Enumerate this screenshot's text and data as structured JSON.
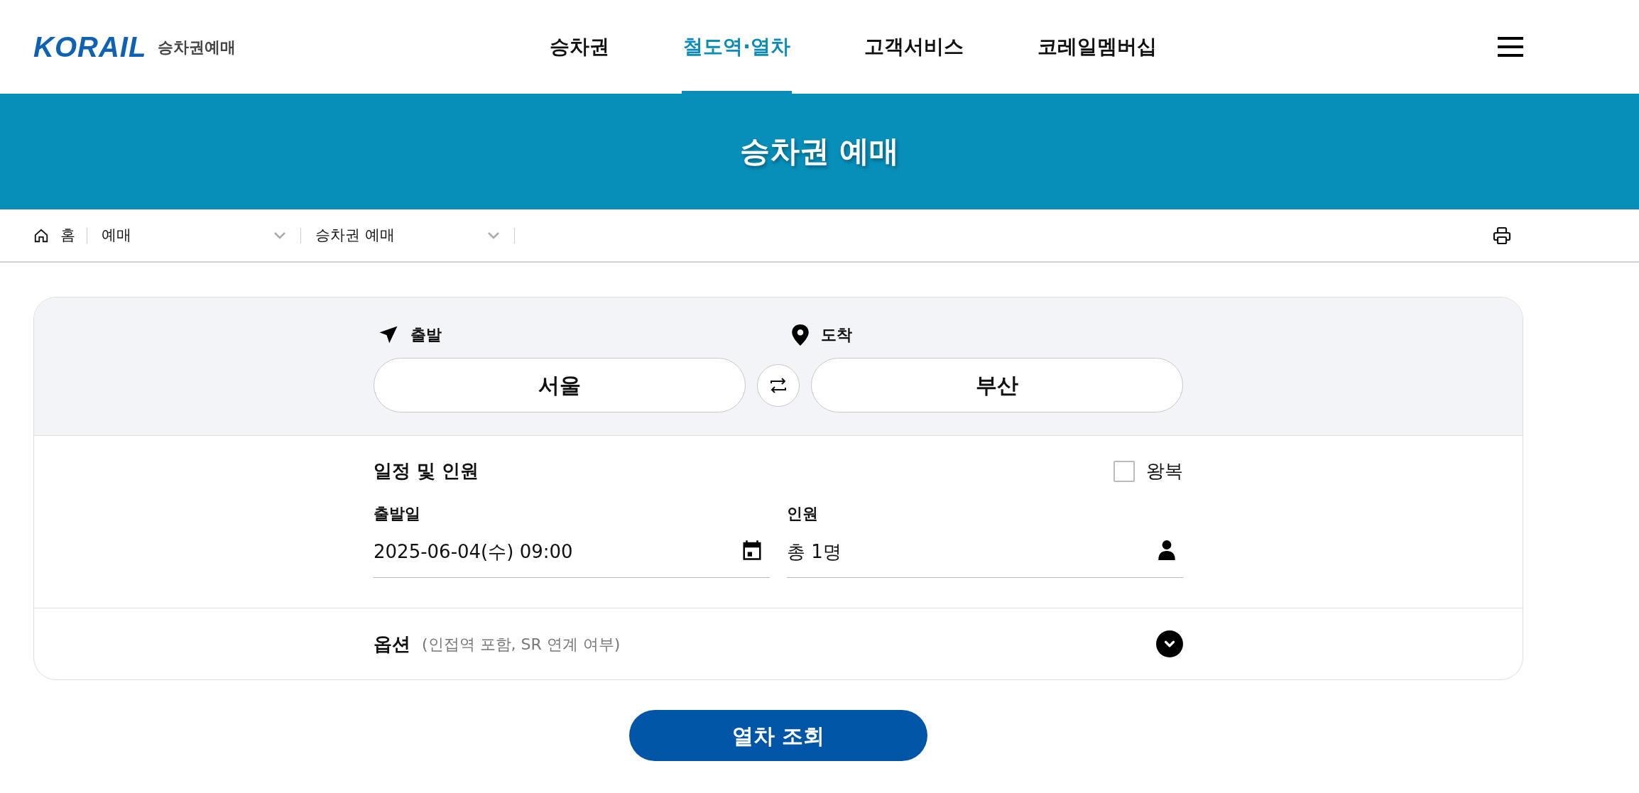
{
  "header": {
    "logo": {
      "brand": "KORAIL",
      "subtitle": "승차권예매"
    },
    "nav": [
      {
        "label": "승차권",
        "selected": false
      },
      {
        "label": "철도역·열차",
        "selected": true
      },
      {
        "label": "고객서비스",
        "selected": false
      },
      {
        "label": "코레일멤버십",
        "selected": false
      }
    ]
  },
  "banner": {
    "title": "승차권 예매"
  },
  "breadcrumb": {
    "home": "홈",
    "levels": [
      "예매",
      "승차권 예매"
    ]
  },
  "route": {
    "departure": {
      "label": "출발",
      "station": "서울"
    },
    "arrival": {
      "label": "도착",
      "station": "부산"
    }
  },
  "schedule": {
    "title": "일정 및 인원",
    "round_trip": {
      "label": "왕복",
      "checked": false
    },
    "date": {
      "label": "출발일",
      "value": "2025-06-04(수) 09:00"
    },
    "passengers": {
      "label": "인원",
      "value": "총 1명"
    }
  },
  "options": {
    "title": "옵션",
    "hint": "(인접역 포함, SR 연계 여부)",
    "expanded": false
  },
  "search_button": "열차 조회"
}
